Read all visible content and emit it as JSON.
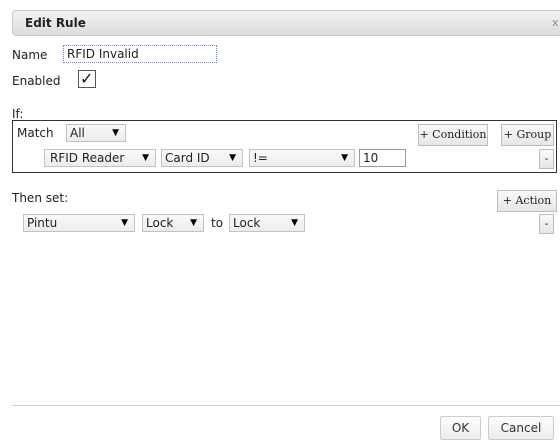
{
  "dialog": {
    "title": "Edit Rule",
    "close_glyph": "x"
  },
  "form": {
    "name_label": "Name",
    "name_value": "RFID Invalid",
    "enabled_label": "Enabled",
    "enabled_checked": true,
    "check_glyph": "✓"
  },
  "if_section": {
    "label": "If:",
    "match_label": "Match",
    "match_value": "All",
    "add_condition_label": "+ Condition",
    "add_group_label": "+ Group",
    "condition": {
      "device": "RFID Reader",
      "property": "Card ID",
      "operator": "!=",
      "value": "10",
      "remove_label": "-"
    }
  },
  "then_section": {
    "label": "Then set:",
    "add_action_label": "+ Action",
    "action": {
      "device": "Pintu",
      "property": "Lock",
      "to_label": "to",
      "value": "Lock",
      "remove_label": "-"
    }
  },
  "footer": {
    "ok_label": "OK",
    "cancel_label": "Cancel"
  },
  "icons": {
    "dropdown_arrow": "chevron-down-icon",
    "close": "close-icon",
    "checkbox": "check-icon"
  }
}
